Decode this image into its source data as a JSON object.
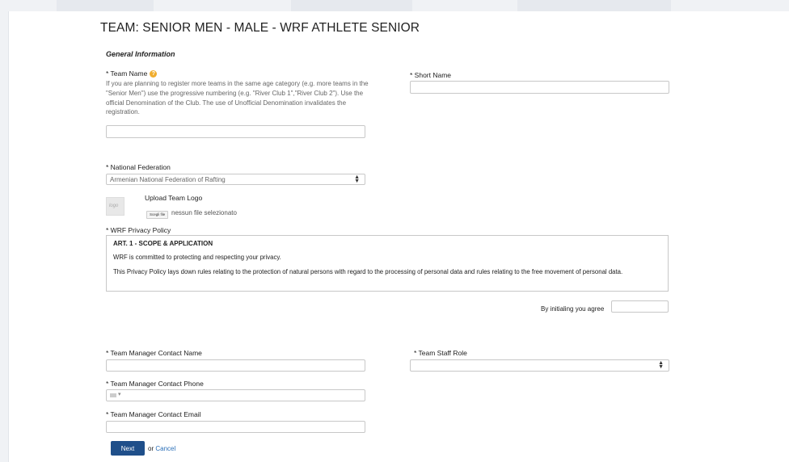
{
  "page": {
    "title": "TEAM: SENIOR MEN - MALE - WRF ATHLETE SENIOR"
  },
  "section": {
    "general": "General Information"
  },
  "team_name": {
    "label": "* Team Name",
    "help": "If you are planning to register more teams in the same age category (e.g. more teams in the \"Senior Men\") use the progressive numbering (e.g. \"River Club 1\",\"River Club 2\"). Use the official Denomination of the Club. The use of Unofficial Denomination invalidates the registration.",
    "value": ""
  },
  "short_name": {
    "label": "* Short Name",
    "value": ""
  },
  "national_federation": {
    "label": "* National Federation",
    "selected": "Armenian National Federation of Rafting"
  },
  "upload_logo": {
    "label": "Upload Team Logo",
    "button": "Scegli file",
    "status": "nessun file selezionato"
  },
  "privacy": {
    "label": "* WRF Privacy Policy",
    "heading": "ART. 1 - SCOPE & APPLICATION",
    "p1": "WRF is committed to protecting and respecting your privacy.",
    "p2": "This Privacy Policy lays down rules relating to the protection of natural persons with regard to the processing of personal data and rules relating to the free movement of personal data.",
    "agree_label": "By initialing you agree",
    "initials": ""
  },
  "manager_name": {
    "label": "* Team Manager Contact Name",
    "value": ""
  },
  "staff_role": {
    "label": "* Team Staff Role",
    "selected": ""
  },
  "manager_phone": {
    "label": "* Team Manager Contact Phone",
    "value": ""
  },
  "manager_email": {
    "label": "* Team Manager Contact Email",
    "value": ""
  },
  "actions": {
    "next": "Next",
    "or": "or",
    "cancel": "Cancel"
  },
  "colors": {
    "primary_button": "#1f4f8a",
    "link": "#2a6fb8",
    "help_icon": "#f0ad2e"
  }
}
